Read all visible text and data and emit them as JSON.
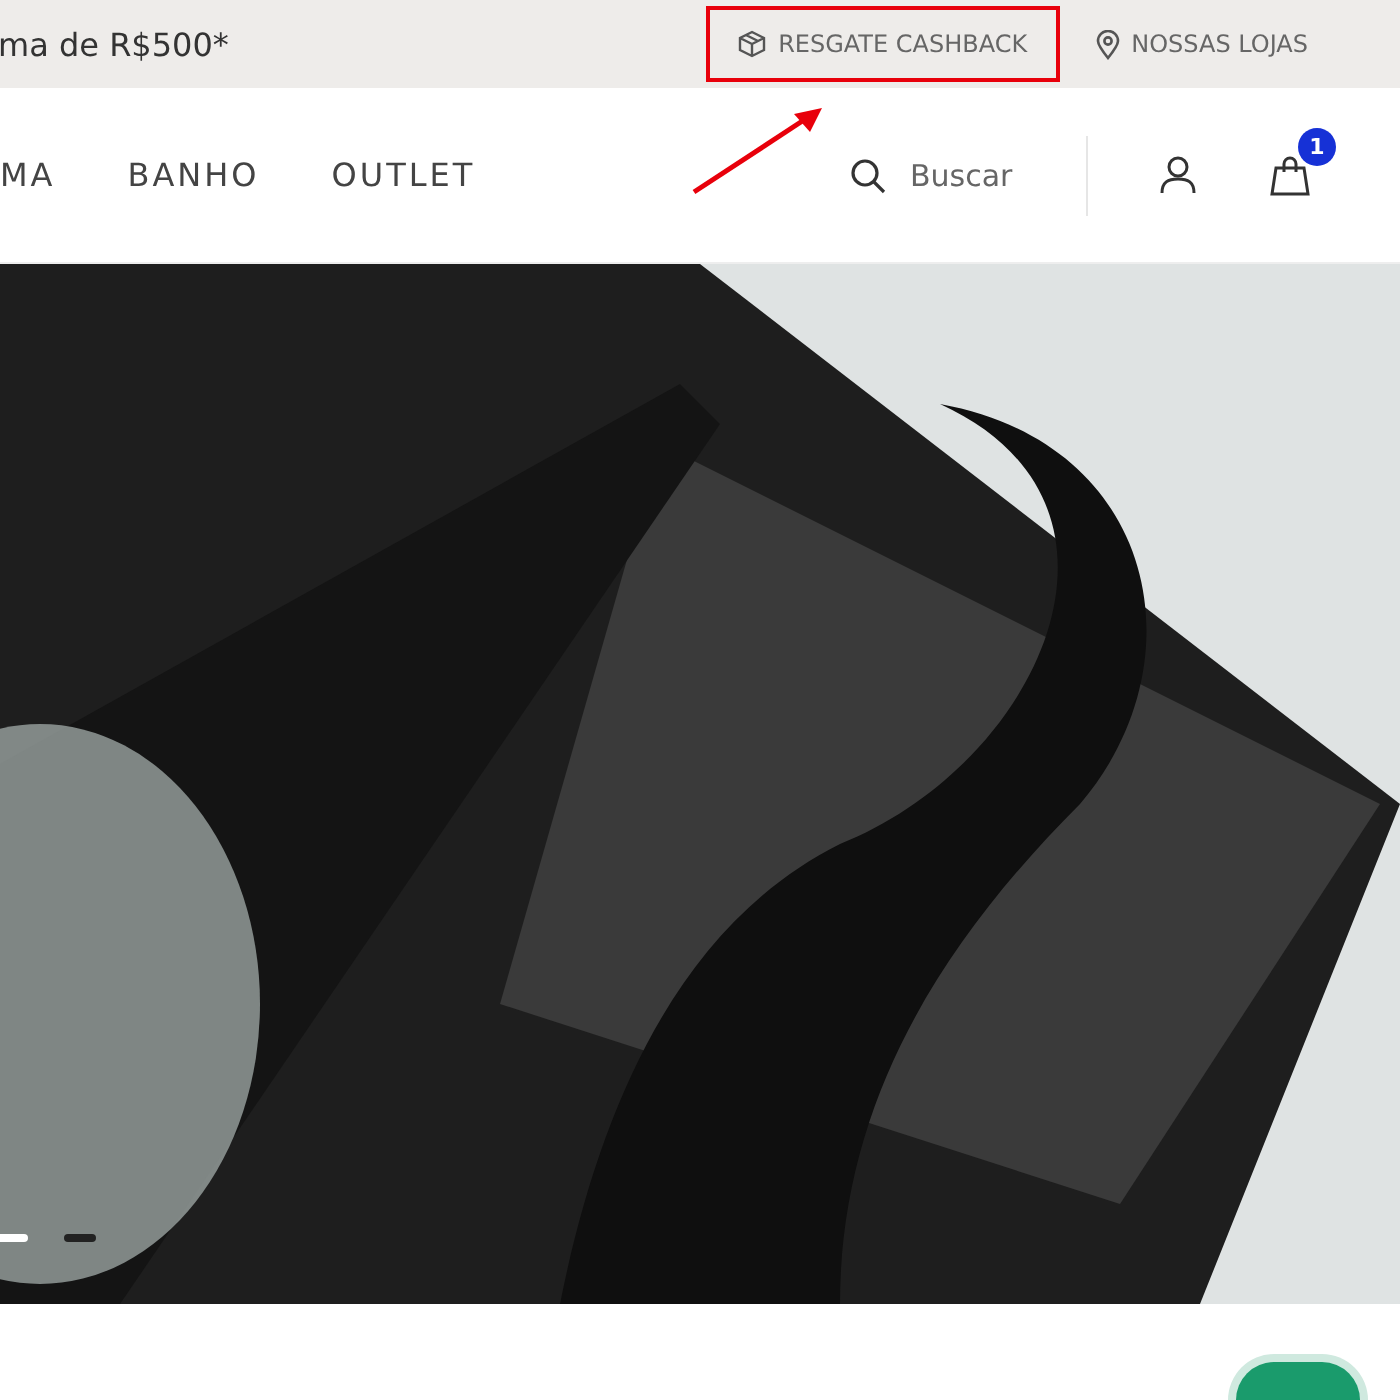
{
  "top_bar": {
    "promo": "ma de R$500*",
    "links": [
      {
        "kind": "cashback",
        "label": "RESGATE CASHBACK",
        "highlighted": true
      },
      {
        "kind": "stores",
        "label": "NOSSAS LOJAS",
        "highlighted": false
      }
    ]
  },
  "nav": {
    "items": [
      "MA",
      "BANHO",
      "OUTLET"
    ],
    "search": {
      "placeholder": "Buscar"
    },
    "cart_count": "1"
  },
  "hero": {
    "slides": [
      {
        "selected": true
      },
      {
        "selected": false
      }
    ]
  }
}
